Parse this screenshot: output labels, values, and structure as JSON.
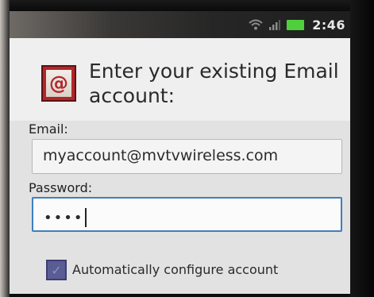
{
  "status_bar": {
    "time": "2:46",
    "icons": [
      "wifi-icon",
      "signal-icon",
      "battery-icon"
    ],
    "battery_color": "#4fcf3c"
  },
  "header": {
    "icon_glyph": "@",
    "icon_color": "#b2262b",
    "title": "Enter your existing Email account:"
  },
  "form": {
    "email_label": "Email:",
    "email_value": "myaccount@mvtvwireless.com",
    "password_label": "Password:",
    "password_value": "••••",
    "focus_color": "#3f7fbf",
    "auto_configure": {
      "label": "Automatically configure account",
      "checked": true
    }
  }
}
